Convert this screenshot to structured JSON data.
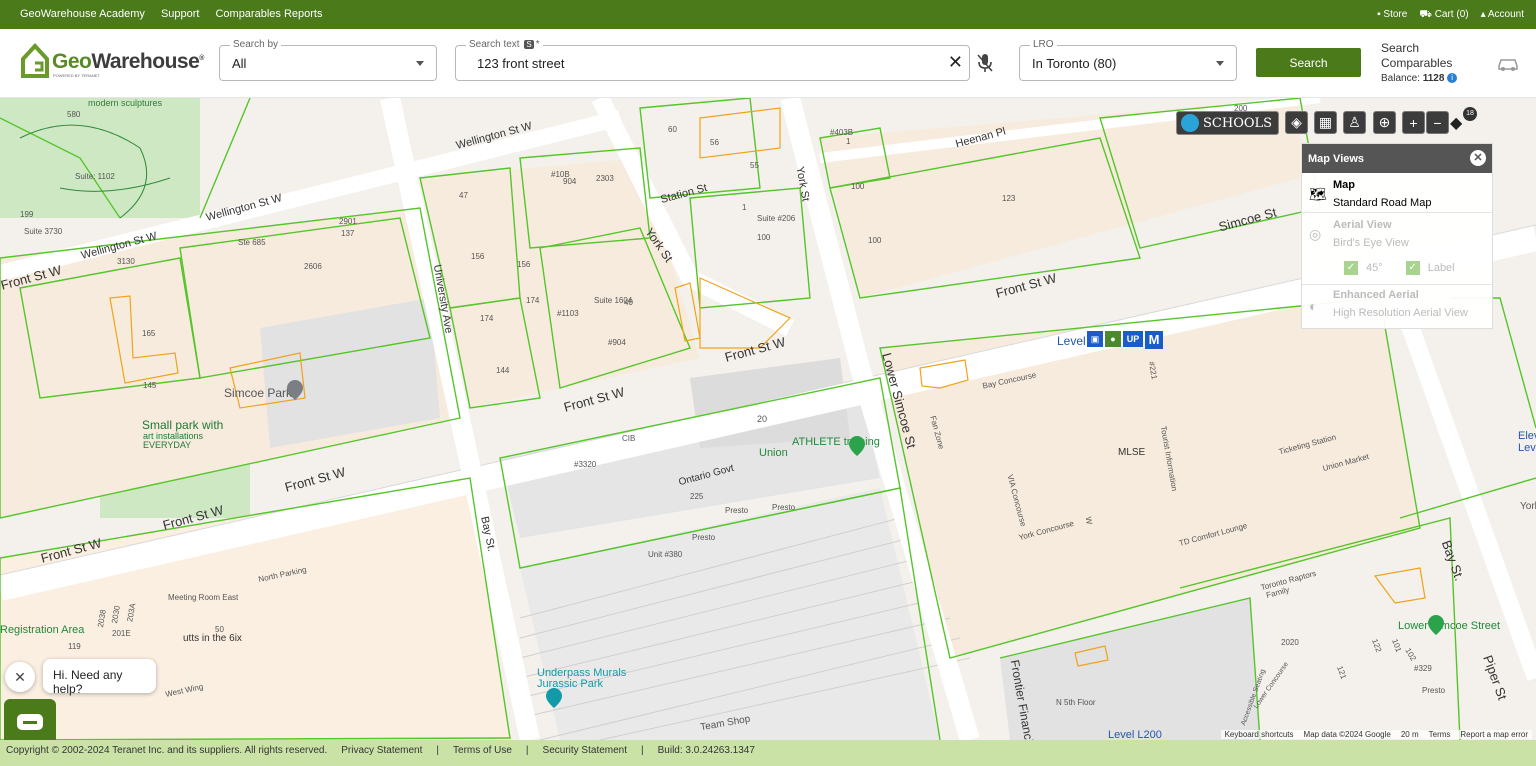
{
  "topbar": {
    "links": [
      "GeoWarehouse Academy",
      "Support",
      "Comparables Reports"
    ],
    "store": "Store",
    "cart": "Cart (0)",
    "account": "Account"
  },
  "logo": {
    "name_a": "Geo",
    "name_b": "Warehouse",
    "reg": "®",
    "powered": "POWERED BY TERANET"
  },
  "search_by": {
    "label": "Search by",
    "value": "All"
  },
  "search_text": {
    "label": "Search text",
    "badge": "S",
    "required": "*",
    "value": "123 front street"
  },
  "lro": {
    "label": "LRO",
    "value": "In Toronto (80)"
  },
  "search_button": "Search",
  "comparables": {
    "line1": "Search",
    "line2": "Comparables",
    "balance_label": "Balance:",
    "balance_value": "1128"
  },
  "map": {
    "schools_label": "SCHOOLS",
    "badge_count": "18",
    "labels": [
      {
        "t": "modern sculptures"
      },
      {
        "t": "Wellington St W"
      },
      {
        "t": "Wellington St W"
      },
      {
        "t": "Wellington St W"
      },
      {
        "t": "Front St W"
      },
      {
        "t": "Front St W"
      },
      {
        "t": "Front St W"
      },
      {
        "t": "Front St W"
      },
      {
        "t": "Front St W"
      },
      {
        "t": "Front St W"
      },
      {
        "t": "Front St W"
      },
      {
        "t": "Simcoe St"
      },
      {
        "t": "University Ave"
      },
      {
        "t": "York St"
      },
      {
        "t": "York St"
      },
      {
        "t": "Lower Simcoe St"
      },
      {
        "t": "Bay St."
      },
      {
        "t": "Bay St."
      },
      {
        "t": "Piper St"
      },
      {
        "t": "Heenan Pl"
      },
      {
        "t": "Station St"
      },
      {
        "t": "Ontario Govt"
      },
      {
        "t": "Simcoe Park"
      },
      {
        "t": "Small park with"
      },
      {
        "t": "art installations"
      },
      {
        "t": "EVERYDAY"
      },
      {
        "t": "ATHLETE training"
      },
      {
        "t": "Union"
      },
      {
        "t": "Level B1"
      },
      {
        "t": "MLSE"
      },
      {
        "t": "Lower Simcoe Street"
      },
      {
        "t": "Underpass Murals"
      },
      {
        "t": "Jurassic Park"
      },
      {
        "t": "Level L200"
      },
      {
        "t": "utts in the 6ix"
      },
      {
        "t": "Registration Area"
      },
      {
        "t": "Meeting Room East"
      },
      {
        "t": "North Parking"
      },
      {
        "t": "West Wing"
      },
      {
        "t": "Bay Concourse"
      },
      {
        "t": "Ticketing Station"
      },
      {
        "t": "Union Market"
      },
      {
        "t": "TD Comfort Lounge"
      },
      {
        "t": "York Concourse"
      },
      {
        "t": "VIA Concourse"
      },
      {
        "t": "Tourist Information"
      },
      {
        "t": "Fan Zone"
      },
      {
        "t": "Toronto Raptors"
      },
      {
        "t": "Family"
      },
      {
        "t": "Presto"
      },
      {
        "t": "Presto"
      },
      {
        "t": "Presto"
      },
      {
        "t": "Presto"
      },
      {
        "t": "Unit #380"
      },
      {
        "t": "Suite: 1102"
      },
      {
        "t": "Suite 3730"
      },
      {
        "t": "Ste 685"
      },
      {
        "t": "Suite 1604"
      },
      {
        "t": "Suite #206"
      },
      {
        "t": "N 5th Floor"
      },
      {
        "t": "#904"
      },
      {
        "t": "#10B"
      },
      {
        "t": "#1103"
      },
      {
        "t": "#403B"
      },
      {
        "t": "#3320"
      },
      {
        "t": "200"
      },
      {
        "t": "580"
      },
      {
        "t": "199"
      },
      {
        "t": "3130"
      },
      {
        "t": "2901"
      },
      {
        "t": "137"
      },
      {
        "t": "2606"
      },
      {
        "t": "165"
      },
      {
        "t": "145"
      },
      {
        "t": "47"
      },
      {
        "t": "156"
      },
      {
        "t": "156"
      },
      {
        "t": "174"
      },
      {
        "t": "174"
      },
      {
        "t": "144"
      },
      {
        "t": "40"
      },
      {
        "t": "904"
      },
      {
        "t": "2303"
      },
      {
        "t": "60"
      },
      {
        "t": "56"
      },
      {
        "t": "55"
      },
      {
        "t": "1"
      },
      {
        "t": "1"
      },
      {
        "t": "100"
      },
      {
        "t": "100"
      },
      {
        "t": "100"
      },
      {
        "t": "123"
      },
      {
        "t": "20"
      },
      {
        "t": "225"
      },
      {
        "t": "50"
      },
      {
        "t": "2020"
      },
      {
        "t": "2038"
      },
      {
        "t": "2030"
      },
      {
        "t": "203A"
      },
      {
        "t": "201E"
      },
      {
        "t": "119"
      },
      {
        "t": "121"
      },
      {
        "t": "122"
      },
      {
        "t": "101"
      },
      {
        "t": "102"
      },
      {
        "t": "#329"
      },
      {
        "t": "#221"
      },
      {
        "t": "W"
      },
      {
        "t": "CIB"
      },
      {
        "t": "Elev"
      },
      {
        "t": "Leve"
      },
      {
        "t": "York"
      },
      {
        "t": "Frontier Financial Centre"
      },
      {
        "t": "Team Shop"
      },
      {
        "t": "Accessible Seating"
      },
      {
        "t": "Lower Concourse"
      }
    ]
  },
  "map_views": {
    "title": "Map Views",
    "options": [
      {
        "title": "Map",
        "sub": "Standard Road Map",
        "enabled": true
      },
      {
        "title": "Aerial View",
        "sub": "Bird's Eye View",
        "enabled": false
      },
      {
        "title": "Enhanced Aerial",
        "sub": "High Resolution Aerial View",
        "enabled": false
      }
    ],
    "check_45": "45°",
    "check_label": "Label"
  },
  "chat": {
    "bubble": "Hi. Need any help?"
  },
  "map_footer": {
    "keys": "Keyboard shortcuts",
    "data": "Map data ©2024 Google",
    "scale": "20 m",
    "terms": "Terms",
    "report": "Report a map error"
  },
  "footer": {
    "copyright": "Copyright © 2002-2024 Teranet Inc. and its suppliers. All rights reserved.",
    "privacy": "Privacy Statement",
    "terms": "Terms of Use",
    "security": "Security Statement",
    "build": "Build: 3.0.24263.1347",
    "sep": "|"
  }
}
